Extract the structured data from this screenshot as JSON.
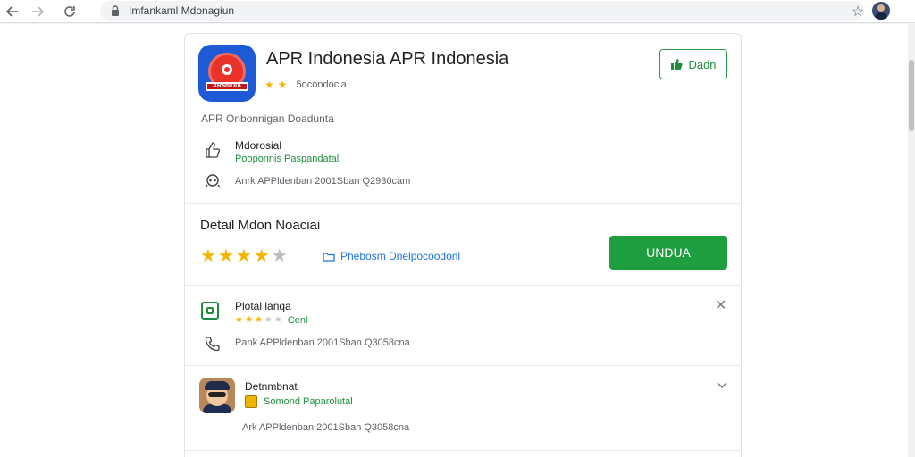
{
  "browser": {
    "url": "Imfankaml Mdonagiun"
  },
  "app": {
    "title": "APR Indonesia APR Indonesia",
    "icon_label": "ARNNDIA",
    "rating_text": "5ocondocia",
    "rating_stars": 2,
    "install_label": "Dadn",
    "subtitle": "APR  Onbonnigan Doadunta"
  },
  "info": {
    "item1_title": "Mdorosial",
    "item1_sub": "Pooponnis Paspandatal",
    "item2_meta": "Anrk APPldenban 2001Sban  Q2930cam"
  },
  "detail": {
    "title": "Detail Mdon Noaciai",
    "stars_filled": 4,
    "publisher_link": "Phebosm Dnelpocoodonl",
    "download_label": "UNDUA"
  },
  "list": [
    {
      "title": "Plotal lanqa",
      "rating_label": "Cenl",
      "stars_filled": 3,
      "meta": "Pank APPldenban 2001Sban  Q3058cna"
    },
    {
      "title": "Detnmbnat",
      "subtitle": "Somond Paparolutal",
      "meta": "Ark APPldenban 2001Sban  Q3058cna"
    }
  ],
  "colors": {
    "accent_green": "#1e9e3f",
    "star_yellow": "#f4b400",
    "link_blue": "#1a73e8"
  }
}
